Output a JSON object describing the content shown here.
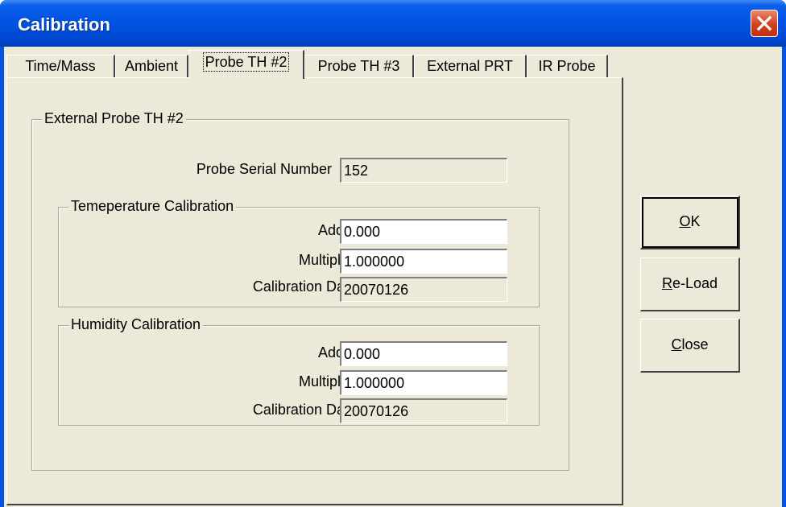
{
  "window": {
    "title": "Calibration"
  },
  "tabs": [
    {
      "label": "Time/Mass"
    },
    {
      "label": "Ambient"
    },
    {
      "label": "Probe TH #2",
      "active": true
    },
    {
      "label": "Probe TH #3"
    },
    {
      "label": "External PRT"
    },
    {
      "label": "IR Probe"
    }
  ],
  "probe_group": {
    "title": "External Probe TH #2",
    "serial_label": "Probe Serial Number",
    "serial_value": "152",
    "temperature": {
      "title": "Temeperature Calibration",
      "adder_label": "Adder",
      "adder_value": "0.000",
      "multiplier_label": "Multiplier",
      "multiplier_value": "1.000000",
      "date_label": "Calibration Date",
      "date_value": "20070126"
    },
    "humidity": {
      "title": "Humidity Calibration",
      "adder_label": "Adder",
      "adder_value": "0.000",
      "multiplier_label": "Multiplier",
      "multiplier_value": "1.000000",
      "date_label": "Calibration Date",
      "date_value": "20070126"
    }
  },
  "buttons": {
    "ok": {
      "mnemonic": "O",
      "rest": "K"
    },
    "reload": {
      "mnemonic": "R",
      "rest": "e-Load"
    },
    "close": {
      "mnemonic": "C",
      "rest": "lose"
    }
  },
  "icons": {
    "close": "close-x-icon"
  },
  "colors": {
    "titlebar": "#0054e3",
    "close_button": "#d3401f",
    "dialog_face": "#ece9d8"
  }
}
